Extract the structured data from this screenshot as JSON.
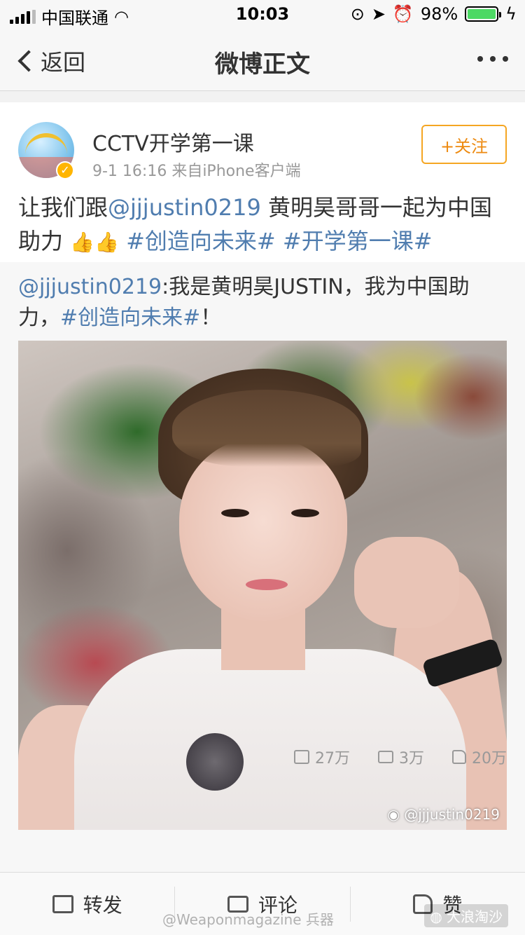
{
  "status_bar": {
    "carrier": "中国联通",
    "time": "10:03",
    "battery": "98%"
  },
  "nav": {
    "back_label": "返回",
    "title": "微博正文"
  },
  "post": {
    "username": "CCTV开学第一课",
    "meta": "9-1 16:16  来自iPhone客户端",
    "follow_label": "+关注",
    "text_prefix": "让我们跟",
    "mention": "@jjjustin0219",
    "text_mid": "  黄明昊哥哥一起为中国助力 ",
    "thumbs": "👍👍",
    "tag1": "#创造向未来#",
    "tag2": "#开学第一课#"
  },
  "repost": {
    "mention": "@jjjustin0219",
    "text": ":我是黄明昊JUSTIN，我为中国助力，",
    "tag": "#创造向未来#",
    "suffix": "！",
    "photo_watermark": "@jjjustin0219"
  },
  "stats": {
    "reposts": "27万",
    "comments": "3万",
    "likes": "20万"
  },
  "toolbar": {
    "repost_label": "转发",
    "comment_label": "评论",
    "like_label": "赞"
  },
  "overlay": {
    "weibo_watermark": "@Weaponmagazine 兵器",
    "corner_watermark": "大浪淘沙"
  },
  "colors": {
    "link": "#507daf",
    "follow": "#ed8a10",
    "battery": "#4cd964"
  }
}
